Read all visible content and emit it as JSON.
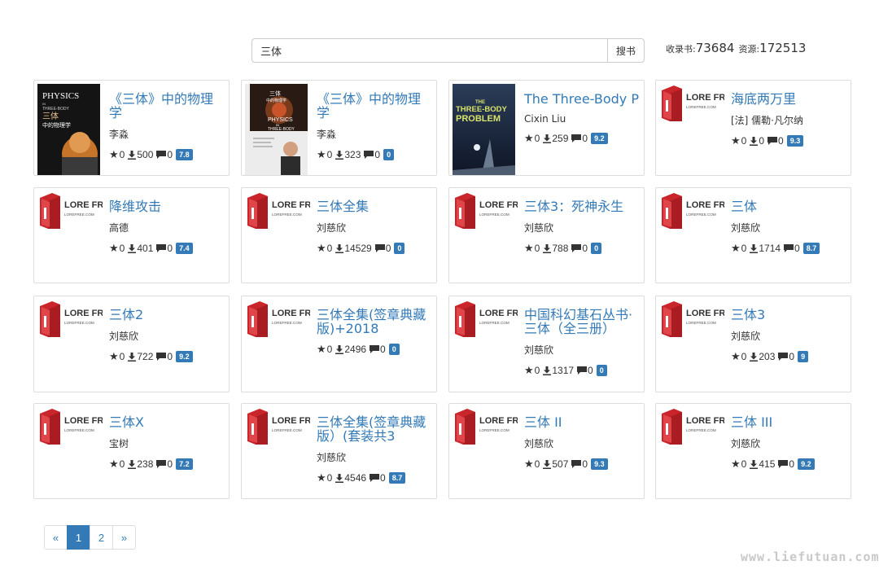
{
  "search": {
    "value": "三体",
    "button_label": "搜书"
  },
  "stats": {
    "books_label": "收录书:",
    "books_count": "73684",
    "resources_label": "资源:",
    "resources_count": "172513"
  },
  "cards": [
    {
      "title": "《三体》中的物理学",
      "author": "李淼",
      "stars": "0",
      "downloads": "500",
      "comments": "0",
      "rating": "7.8",
      "cover": "physics-cover"
    },
    {
      "title": "《三体》中的物理学",
      "author": "李淼",
      "stars": "0",
      "downloads": "323",
      "comments": "0",
      "rating": "0",
      "cover": "physics-cover-2"
    },
    {
      "title": "The Three-Body P",
      "author": "Cixin Liu",
      "stars": "0",
      "downloads": "259",
      "comments": "0",
      "rating": "9.2",
      "cover": "three-body-problem-cover"
    },
    {
      "title": "海底两万里",
      "author": "[法] 儒勒·凡尔纳",
      "stars": "0",
      "downloads": "0",
      "comments": "0",
      "rating": "9.3",
      "cover": "lorefree"
    },
    {
      "title": "降维攻击",
      "author": "高德",
      "stars": "0",
      "downloads": "401",
      "comments": "0",
      "rating": "7.4",
      "cover": "lorefree"
    },
    {
      "title": "三体全集",
      "author": "刘慈欣",
      "stars": "0",
      "downloads": "14529",
      "comments": "0",
      "rating": "0",
      "cover": "lorefree"
    },
    {
      "title": "三体3：死神永生",
      "author": "刘慈欣",
      "stars": "0",
      "downloads": "788",
      "comments": "0",
      "rating": "0",
      "cover": "lorefree"
    },
    {
      "title": "三体",
      "author": "刘慈欣",
      "stars": "0",
      "downloads": "1714",
      "comments": "0",
      "rating": "8.7",
      "cover": "lorefree"
    },
    {
      "title": "三体2",
      "author": "刘慈欣",
      "stars": "0",
      "downloads": "722",
      "comments": "0",
      "rating": "9.2",
      "cover": "lorefree"
    },
    {
      "title": "三体全集(签章典藏版)+2018",
      "author": "",
      "stars": "0",
      "downloads": "2496",
      "comments": "0",
      "rating": "0",
      "cover": "lorefree"
    },
    {
      "title": "中国科幻基石丛书·三体（全三册）",
      "author": "刘慈欣",
      "stars": "0",
      "downloads": "1317",
      "comments": "0",
      "rating": "0",
      "cover": "lorefree"
    },
    {
      "title": "三体3",
      "author": "刘慈欣",
      "stars": "0",
      "downloads": "203",
      "comments": "0",
      "rating": "9",
      "cover": "lorefree"
    },
    {
      "title": "三体X",
      "author": "宝树",
      "stars": "0",
      "downloads": "238",
      "comments": "0",
      "rating": "7.2",
      "cover": "lorefree"
    },
    {
      "title": "三体全集(签章典藏版）(套装共3",
      "author": "刘慈欣",
      "stars": "0",
      "downloads": "4546",
      "comments": "0",
      "rating": "8.7",
      "cover": "lorefree"
    },
    {
      "title": "三体 II",
      "author": "刘慈欣",
      "stars": "0",
      "downloads": "507",
      "comments": "0",
      "rating": "9.3",
      "cover": "lorefree"
    },
    {
      "title": "三体 III",
      "author": "刘慈欣",
      "stars": "0",
      "downloads": "415",
      "comments": "0",
      "rating": "9.2",
      "cover": "lorefree"
    }
  ],
  "covers": {
    "physics": {
      "line1": "PHYSICS",
      "line2": "IN",
      "line3": "THREE-BODY",
      "line4": "三体",
      "line5": "中的物理学"
    },
    "physics2": {
      "line1": "三体",
      "line2": "中的物理学",
      "line3": "PHYSICS",
      "line4": "IN",
      "line5": "THREE-BODY"
    },
    "threebody": {
      "line1": "THE",
      "line2": "THREE-BODY",
      "line3": "PROBLEM"
    },
    "lorefree": {
      "brand": "LORE FREE",
      "domain": "LOREFREE.COM"
    }
  },
  "pagination": {
    "prev": "«",
    "pages": [
      "1",
      "2"
    ],
    "next": "»",
    "active": "1"
  },
  "watermark": "www.liefutuan.com",
  "colors": {
    "link": "#337ab7",
    "badge": "#337ab7",
    "lorefree_red": "#c9252b"
  }
}
